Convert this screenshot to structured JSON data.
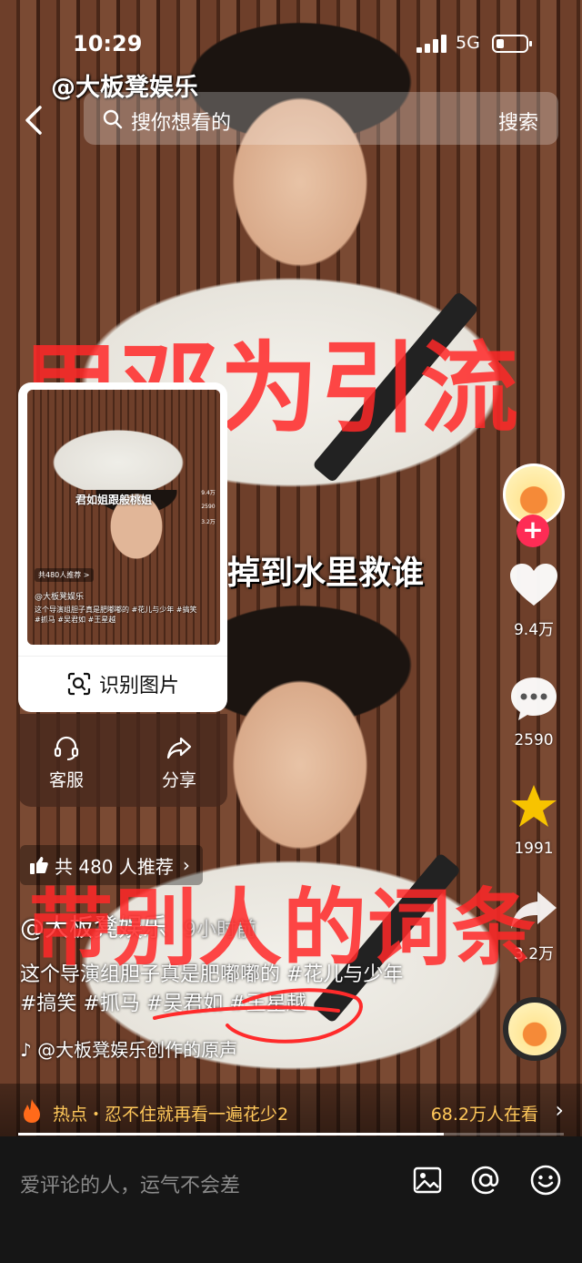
{
  "status_bar": {
    "time": "10:29",
    "network": "5G"
  },
  "watermark": "@大板凳娱乐",
  "search": {
    "placeholder": "搜你想看的",
    "button_label": "搜索"
  },
  "overlays": {
    "top": "用邓为引流",
    "bottom": "带别人的词条"
  },
  "subtitle_mid": "掉到水里救谁",
  "popup": {
    "thumb_caption": "君如姐跟般桃姐",
    "thumb_recommend": "共480人推荐 >",
    "thumb_author": "@大板凳娱乐",
    "thumb_desc": "这个导演组胆子真是肥嘟嘟的 #花儿与少年 #搞笑 #抓马 #吴君如 #王星越",
    "thumb_side": [
      "9.4万",
      "2590",
      "3.2万"
    ],
    "recognize_label": "识别图片",
    "actions": [
      {
        "label": "客服",
        "icon": "headset-icon"
      },
      {
        "label": "分享",
        "icon": "share-arrow-icon"
      }
    ]
  },
  "rail": {
    "likes": "9.4万",
    "comments": "2590",
    "favorites": "1991",
    "shares": "3.2万",
    "like_color": "#ffffff",
    "favorite_color": "#f7c300"
  },
  "video": {
    "recommend_chip": "共 480 人推荐",
    "author": "@大板凳娱乐",
    "time_ago": "9小时前",
    "desc_line1": "这个导演组胆子真是肥嘟嘟的 #花儿与少年",
    "desc_line2": "#搞笑 #抓马 #吴君如 #王星越",
    "music": "@大板凳娱乐创作的原声",
    "progress": 0.78
  },
  "hot": {
    "text": "热点・忍不住就再看一遍花少2",
    "watching": "68.2万人在看"
  },
  "comment_bar": {
    "placeholder": "爱评论的人，运气不会差"
  },
  "colors": {
    "accent_red": "#fe2c55",
    "hot_text": "#ffc85a",
    "overlay_red": "#ff2828"
  }
}
